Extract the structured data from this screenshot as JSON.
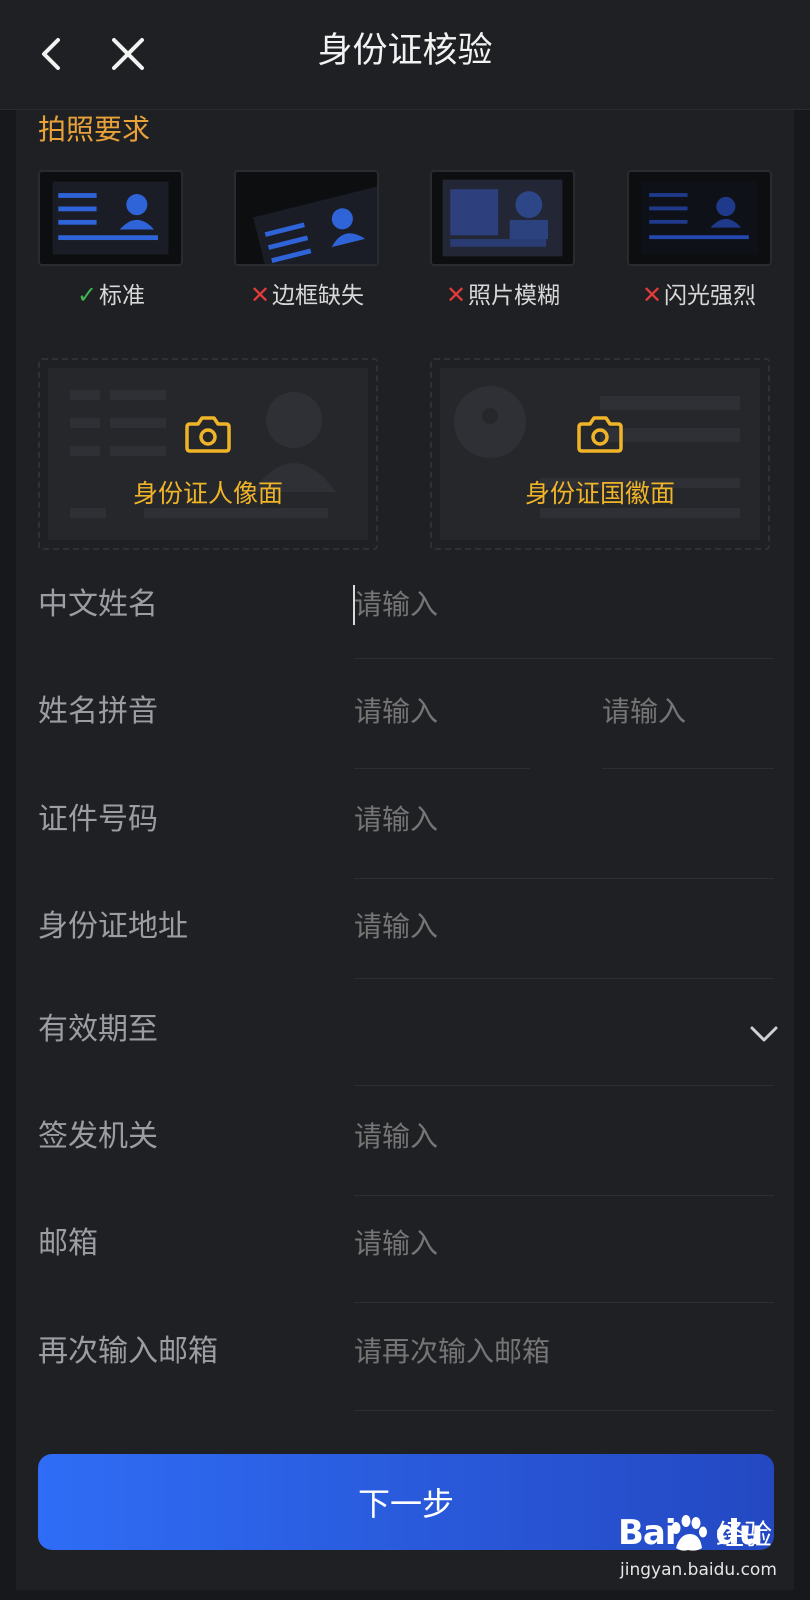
{
  "header": {
    "title": "身份证核验"
  },
  "requirements": {
    "title": "拍照要求",
    "samples": [
      {
        "status": "ok",
        "mark": "✓",
        "label": "标准"
      },
      {
        "status": "bad",
        "mark": "✕",
        "label": "边框缺失"
      },
      {
        "status": "bad",
        "mark": "✕",
        "label": "照片模糊"
      },
      {
        "status": "bad",
        "mark": "✕",
        "label": "闪光强烈"
      }
    ]
  },
  "uploads": {
    "front_label": "身份证人像面",
    "back_label": "身份证国徽面"
  },
  "form": {
    "chinese_name": {
      "label": "中文姓名",
      "placeholder": "请输入"
    },
    "pinyin": {
      "label": "姓名拼音",
      "placeholder_surname": "请输入",
      "placeholder_given": "请输入"
    },
    "id_number": {
      "label": "证件号码",
      "placeholder": "请输入"
    },
    "address": {
      "label": "身份证地址",
      "placeholder": "请输入"
    },
    "validity": {
      "label": "有效期至",
      "value": ""
    },
    "authority": {
      "label": "签发机关",
      "placeholder": "请输入"
    },
    "email": {
      "label": "邮箱",
      "placeholder": "请输入"
    },
    "email_confirm": {
      "label": "再次输入邮箱",
      "placeholder": "请再次输入邮箱"
    }
  },
  "next_button": "下一步",
  "watermark": {
    "logo": "Bai",
    "logo_tail": "du",
    "brand": "经验",
    "url": "jingyan.baidu.com"
  },
  "colors": {
    "accent_orange": "#e8a23a",
    "accent_yellow": "#f0b429",
    "button_blue": "#2f6df6",
    "ok_green": "#3fb34f",
    "bad_red": "#e23b3b"
  }
}
